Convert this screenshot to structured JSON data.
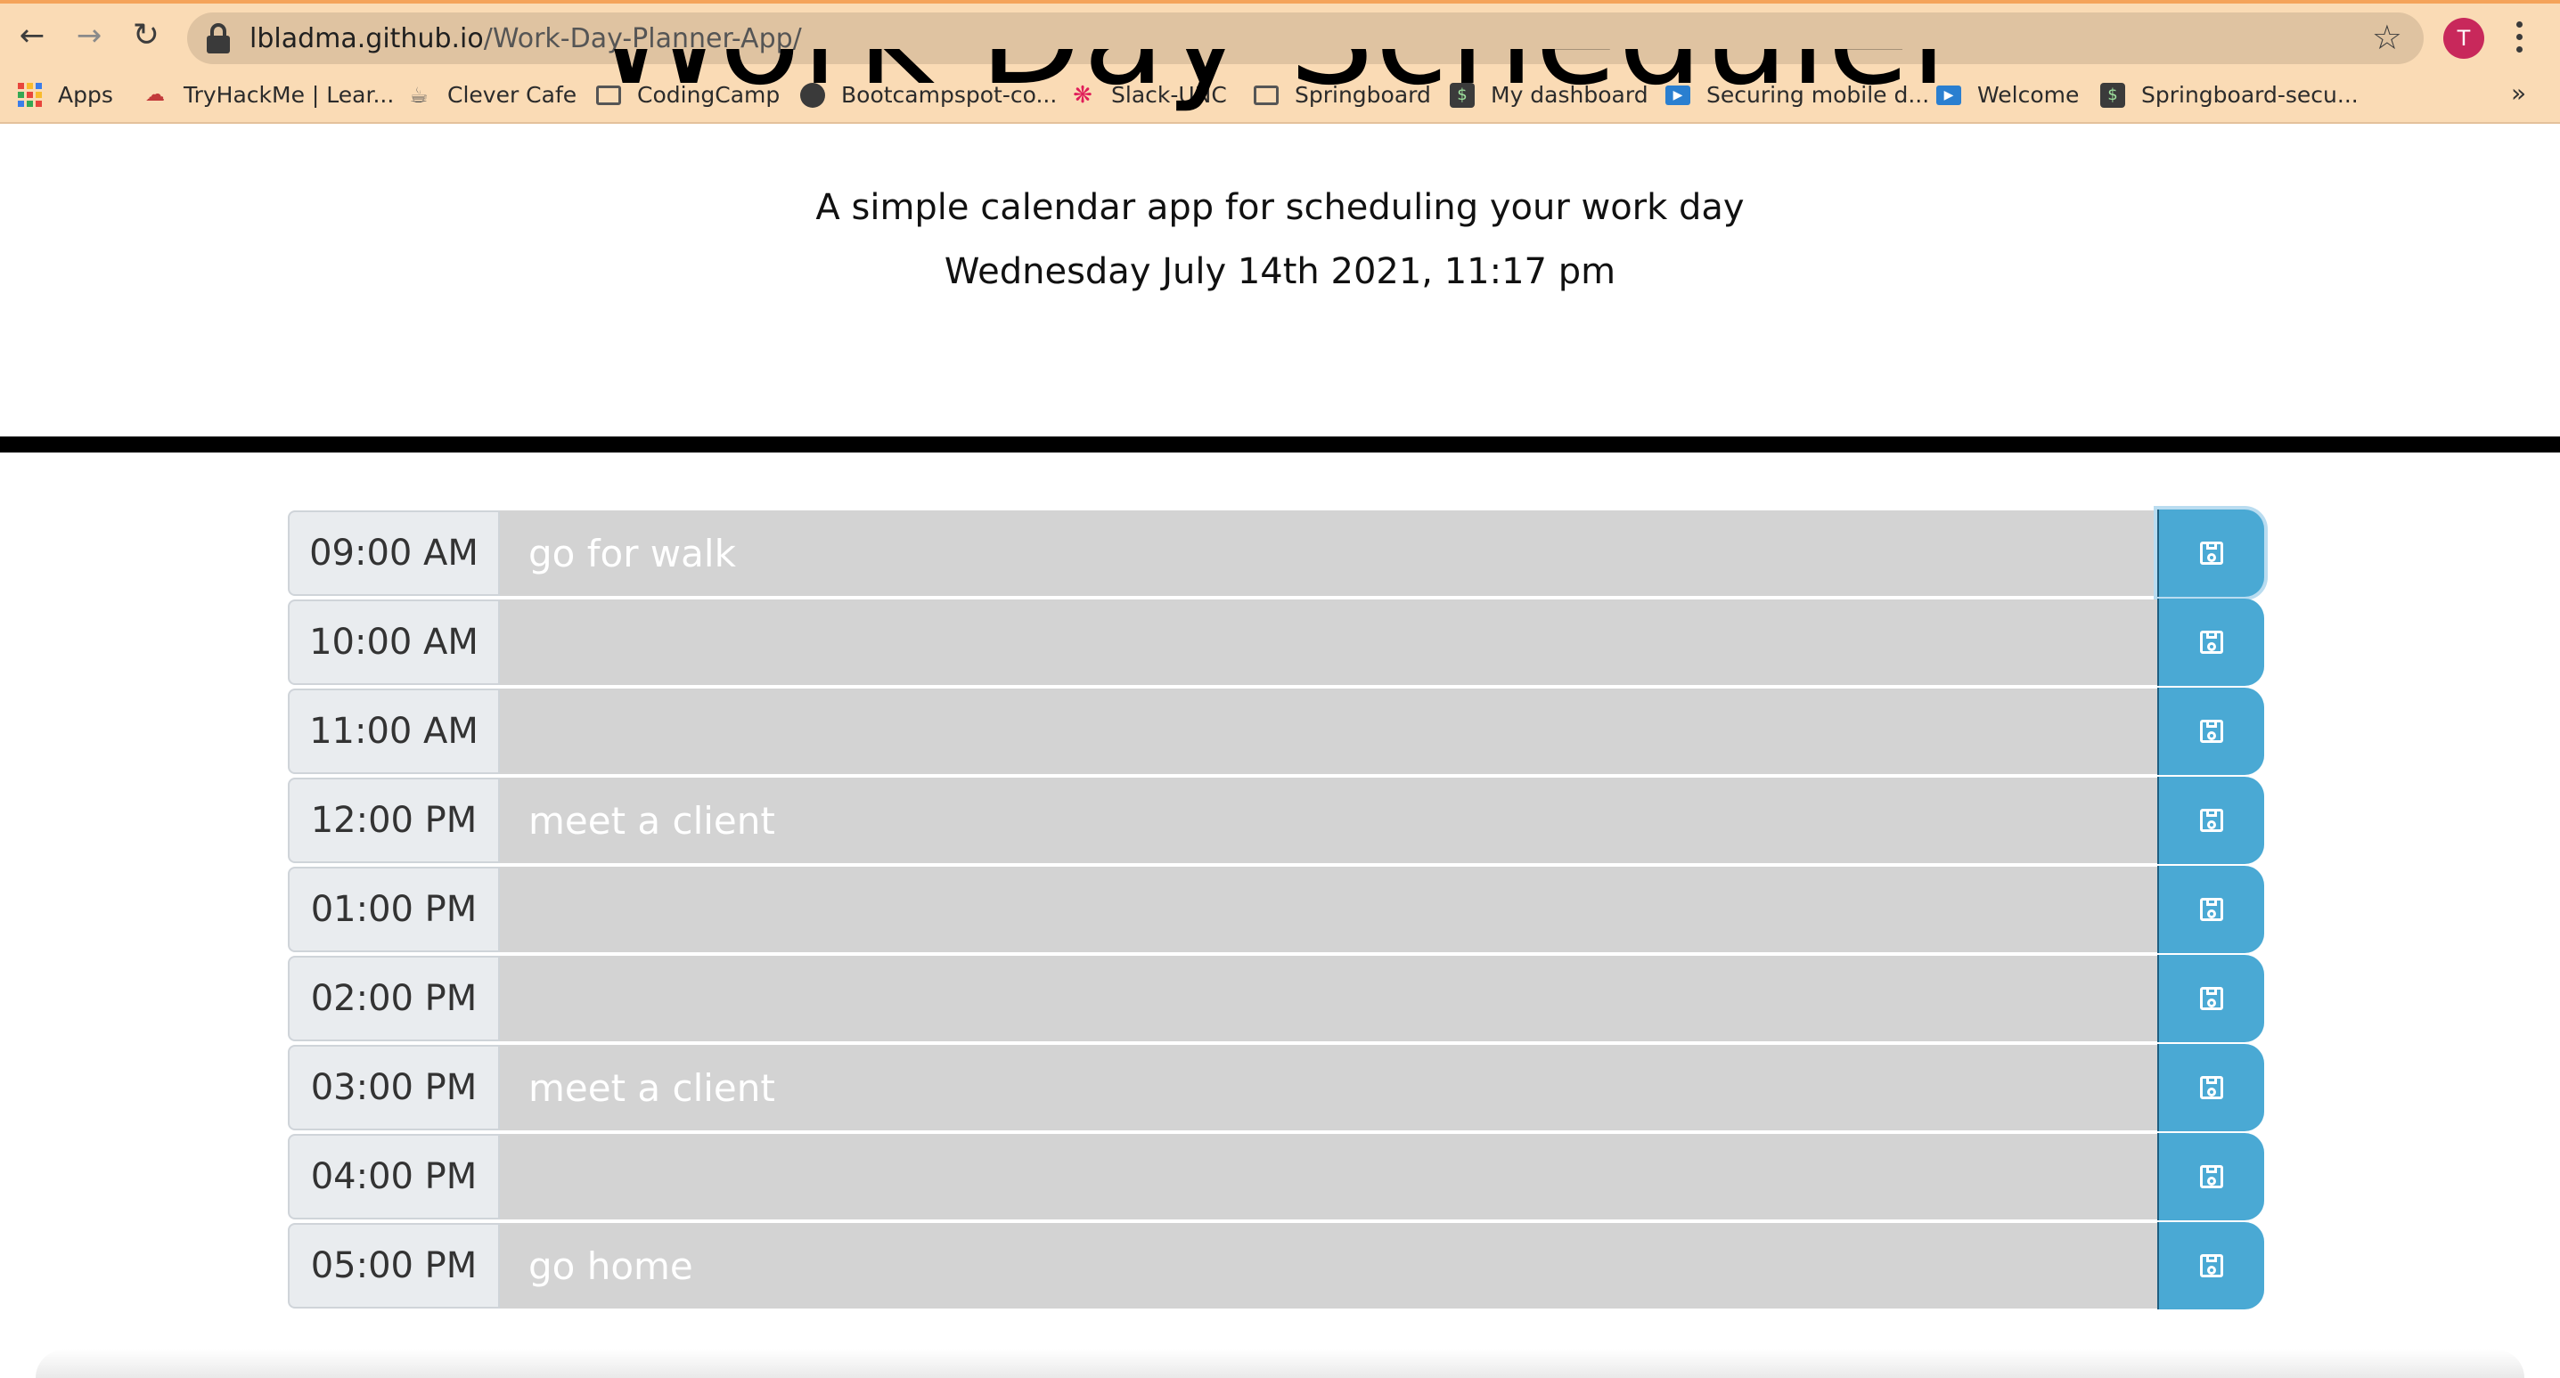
{
  "browser": {
    "url_domain": "lbladma.github.io",
    "url_path": "/Work-Day-Planner-App/",
    "profile_initial": "T",
    "icons": {
      "back": "arrow-left-icon",
      "forward": "arrow-right-icon",
      "reload": "reload-icon",
      "lock": "lock-icon",
      "star": "star-icon",
      "menu": "kebab-menu-icon"
    }
  },
  "bookmarks": [
    {
      "label": "Apps",
      "icon": "apps-grid-icon"
    },
    {
      "label": "TryHackMe | Lear...",
      "icon": "tryhackme-icon"
    },
    {
      "label": "Clever Cafe",
      "icon": "cafe-icon"
    },
    {
      "label": "CodingCamp",
      "icon": "folder-icon"
    },
    {
      "label": "Bootcampspot-co...",
      "icon": "globe-icon"
    },
    {
      "label": "Slack-UNC",
      "icon": "slack-icon"
    },
    {
      "label": "Springboard",
      "icon": "folder-icon"
    },
    {
      "label": "My dashboard",
      "icon": "springboard-icon"
    },
    {
      "label": "Securing mobile d...",
      "icon": "video-icon"
    },
    {
      "label": "Welcome",
      "icon": "video-icon"
    },
    {
      "label": "Springboard-secu...",
      "icon": "springboard-icon"
    }
  ],
  "bookmarks_more": "»",
  "header": {
    "title": "Work Day Scheduler",
    "lead": "A simple calendar app for scheduling your work day",
    "current_day": "Wednesday July 14th 2021, 11:17 pm"
  },
  "schedule": [
    {
      "hour": "09:00 AM",
      "text": "go for walk"
    },
    {
      "hour": "10:00 AM",
      "text": ""
    },
    {
      "hour": "11:00 AM",
      "text": ""
    },
    {
      "hour": "12:00 PM",
      "text": "meet a client"
    },
    {
      "hour": "01:00 PM",
      "text": ""
    },
    {
      "hour": "02:00 PM",
      "text": ""
    },
    {
      "hour": "03:00 PM",
      "text": "meet a client"
    },
    {
      "hour": "04:00 PM",
      "text": ""
    },
    {
      "hour": "05:00 PM",
      "text": "go home"
    }
  ],
  "colors": {
    "topbar": "#fadbb5",
    "row_past": "#d3d3d3",
    "save": "#4aa9d4"
  }
}
